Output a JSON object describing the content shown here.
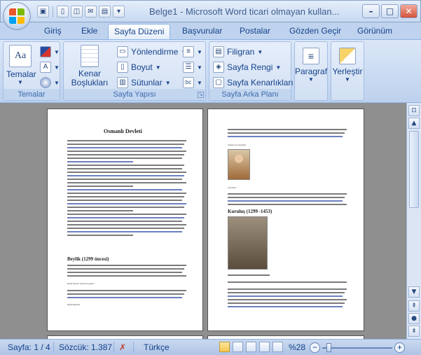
{
  "title_bar": {
    "title": "Belge1 - Microsoft Word ticari olmayan kullan...",
    "qat_icons": [
      "save-icon",
      "undo-icon",
      "redo-icon",
      "new-doc-icon",
      "open-icon",
      "mail-icon",
      "print-preview-icon"
    ]
  },
  "tabs": [
    {
      "label": "Giriş"
    },
    {
      "label": "Ekle"
    },
    {
      "label": "Sayfa Düzeni"
    },
    {
      "label": "Başvurular"
    },
    {
      "label": "Postalar"
    },
    {
      "label": "Gözden Geçir"
    },
    {
      "label": "Görünüm"
    }
  ],
  "active_tab": "Sayfa Düzeni",
  "ribbon": {
    "themes": {
      "group_label": "Temalar",
      "themes_button": "Temalar"
    },
    "page_setup": {
      "group_label": "Sayfa Yapısı",
      "margins_button": "Kenar Boşlukları",
      "orientation": "Yönlendirme",
      "size": "Boyut",
      "columns": "Sütunlar"
    },
    "page_background": {
      "group_label": "Sayfa Arka Planı",
      "watermark": "Filigran",
      "page_color": "Sayfa Rengi",
      "page_borders": "Sayfa Kenarlıkları"
    },
    "paragraph_button": "Paragraf",
    "arrange_button": "Yerleştir"
  },
  "document": {
    "page1": {
      "title": "Osmanlı Devleti",
      "heading": "Beylik (1299 öncesi)",
      "caption_line": "Beylik: Beylerin Anadolu'yu gelmesi",
      "last_line": "Beylik Başlaması"
    },
    "page2": {
      "top_caption": "Osmanlı Gazi döneminin",
      "heading": "Kuruluş (1299 -1453)",
      "caption2": "Gazi Orhan"
    }
  },
  "status_bar": {
    "page": "Sayfa: 1 / 4",
    "words": "Sözcük: 1.387",
    "language": "Türkçe",
    "zoom": "%28",
    "zoom_level_percent": 28
  },
  "colors": {
    "ribbon_text": "#15428b",
    "doc_background": "#8f8f8f"
  }
}
